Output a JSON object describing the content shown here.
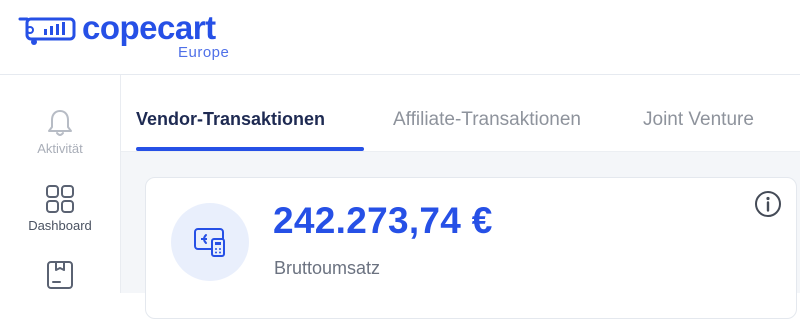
{
  "brand": {
    "name": "copecart",
    "region": "Europe",
    "accent_color": "#2650e6"
  },
  "sidebar": {
    "items": [
      {
        "label": "Aktivität",
        "icon": "bell-icon",
        "muted": true
      },
      {
        "label": "Dashboard",
        "icon": "dashboard-grid-icon",
        "muted": false
      },
      {
        "label": "",
        "icon": "product-box-icon",
        "muted": false
      }
    ]
  },
  "tabs": [
    {
      "label": "Vendor-Transaktionen",
      "active": true
    },
    {
      "label": "Affiliate-Transaktionen",
      "active": false
    },
    {
      "label": "Joint Venture",
      "active": false
    }
  ],
  "revenue_card": {
    "amount": "242.273,74 €",
    "label": "Bruttoumsatz",
    "icon": "money-card-icon",
    "info_icon": "info-icon"
  }
}
